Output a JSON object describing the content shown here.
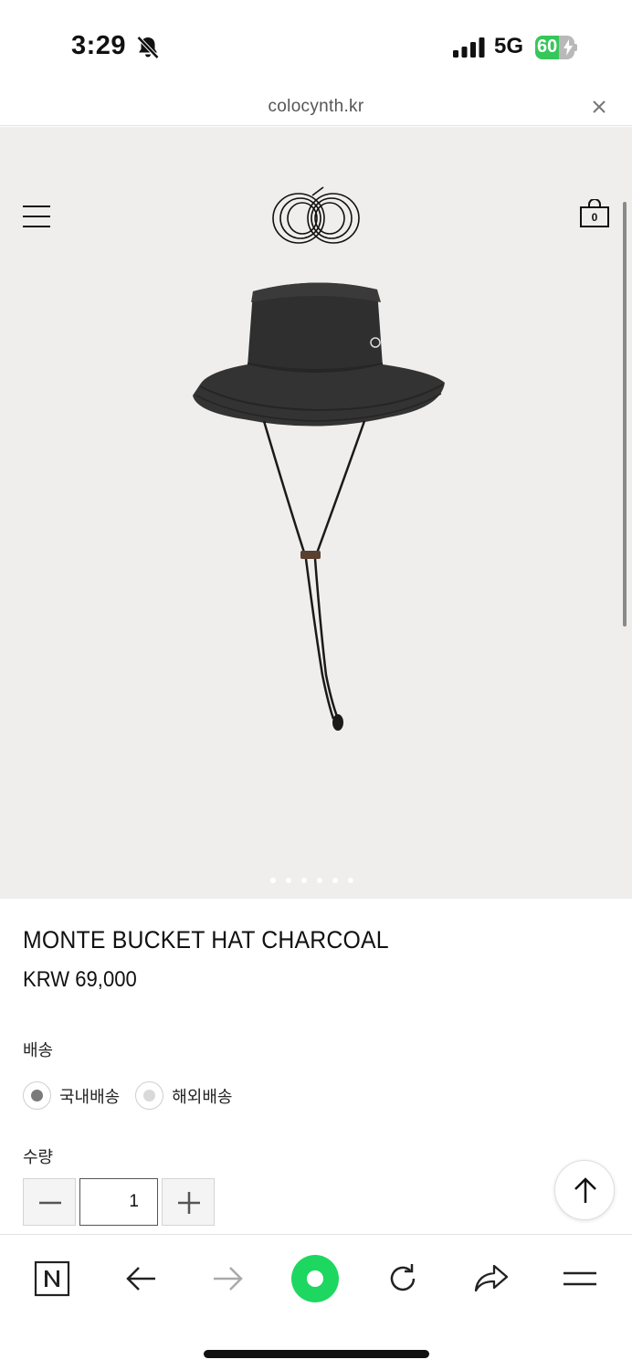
{
  "status_bar": {
    "time": "3:29",
    "network": "5G",
    "battery_percent": "60",
    "battery_level": 0.6
  },
  "url_bar": {
    "domain": "colocynth.kr"
  },
  "header": {
    "cart_count": "0"
  },
  "gallery": {
    "image_count": 6,
    "active_index": 0
  },
  "product": {
    "title": "MONTE BUCKET HAT CHARCOAL",
    "price": "KRW 69,000"
  },
  "options": {
    "shipping_label": "배송",
    "shipping_choices": [
      "국내배송",
      "해외배송"
    ],
    "selected_shipping": "국내배송",
    "quantity_label": "수량",
    "quantity": "1"
  },
  "icons": {
    "bell": "bell-off-icon",
    "signal": "cellular-signal-icon",
    "close": "close-icon",
    "menu": "hamburger-icon",
    "cart": "shopping-bag-icon",
    "top": "arrow-up-icon",
    "naver": "naver-n-icon",
    "back": "arrow-left-icon",
    "forward": "arrow-right-icon",
    "green": "green-dot-icon",
    "reload": "reload-icon",
    "share": "share-icon",
    "more": "menu-icon"
  },
  "colors": {
    "accent_green": "#1ed760",
    "battery_green": "#35c759",
    "hero_bg": "#efeeec"
  }
}
